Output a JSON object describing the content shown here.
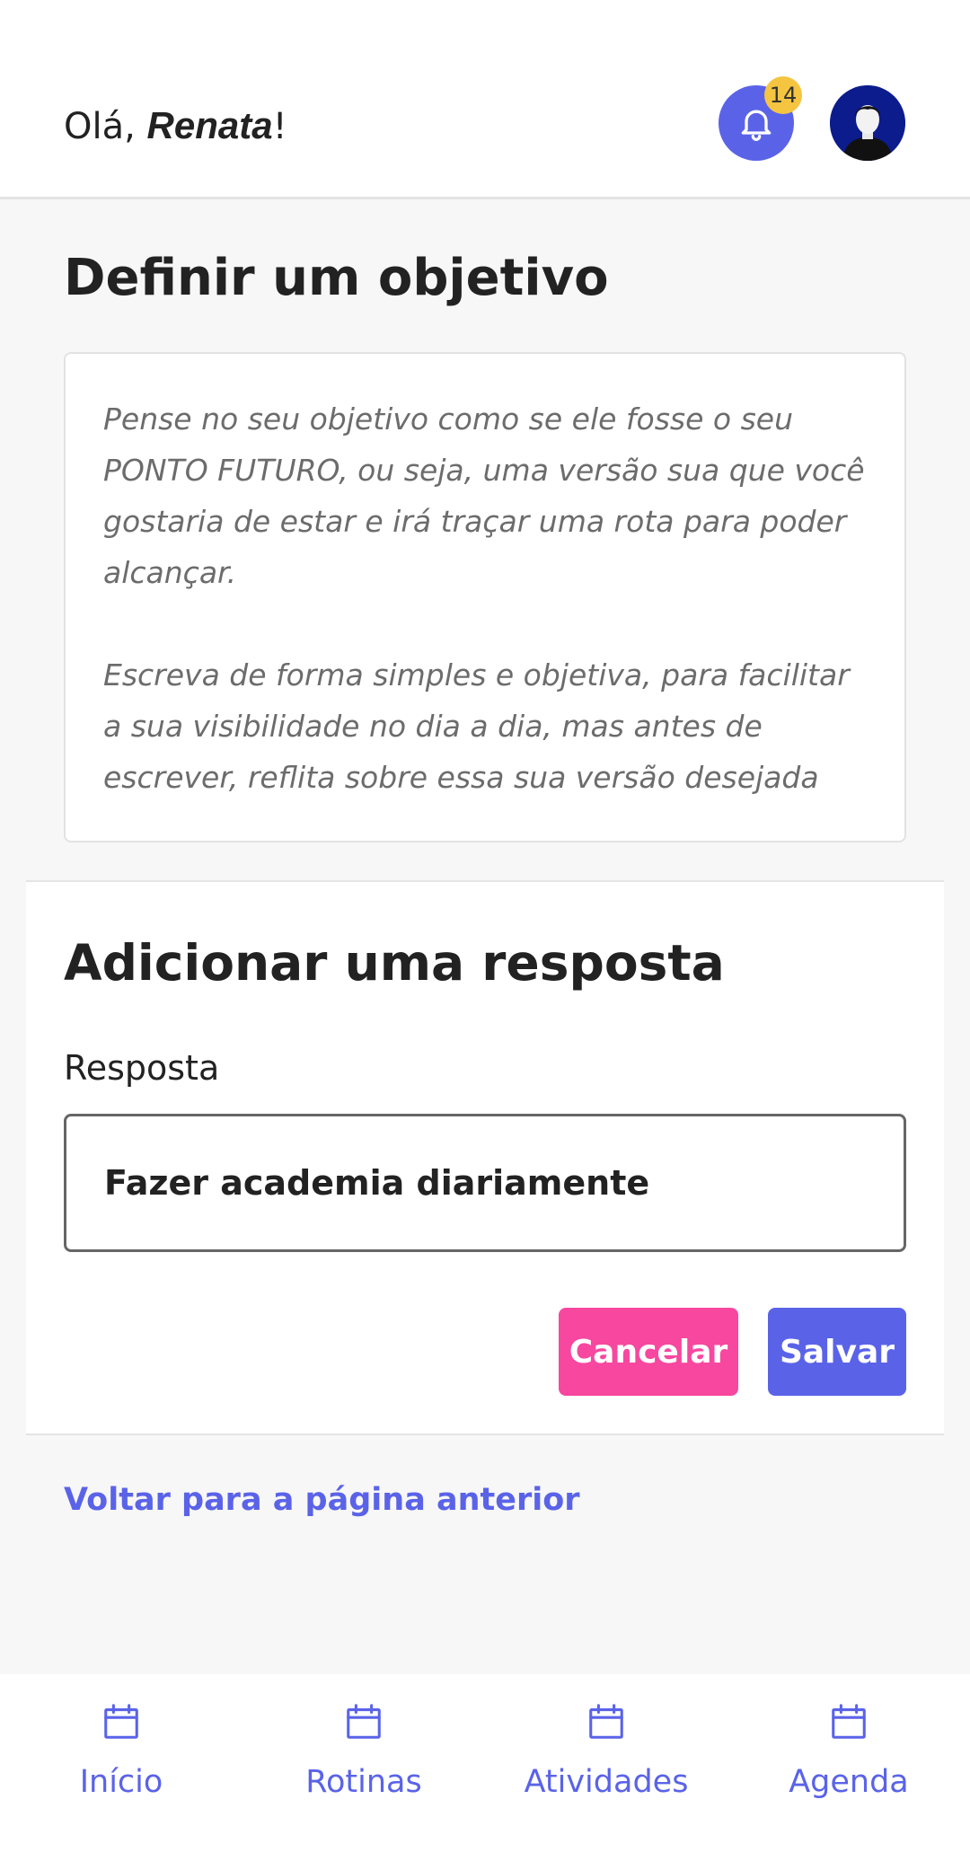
{
  "header": {
    "greeting_prefix": "Olá, ",
    "user_name": "Renata",
    "greeting_suffix": "!",
    "notification_count": "14"
  },
  "page": {
    "title": "Definir um objetivo",
    "info_text": "Pense no seu objetivo como se ele fosse o seu PONTO FUTURO, ou seja, uma versão sua que você gostaria de estar e irá traçar uma rota para poder alcançar.\n\nEscreva de forma simples e objetiva, para facilitar a sua visibilidade no dia a dia, mas antes de escrever, reflita sobre essa sua versão desejada"
  },
  "answer_form": {
    "title": "Adicionar uma resposta",
    "field_label": "Resposta",
    "field_value": "Fazer academia diariamente",
    "cancel_label": "Cancelar",
    "save_label": "Salvar"
  },
  "back_link": "Voltar para a página anterior",
  "nav": {
    "items": [
      {
        "label": "Início",
        "icon": "calendar-icon"
      },
      {
        "label": "Rotinas",
        "icon": "calendar-icon"
      },
      {
        "label": "Atividades",
        "icon": "calendar-icon"
      },
      {
        "label": "Agenda",
        "icon": "calendar-icon"
      }
    ]
  },
  "colors": {
    "accent": "#5a63e8",
    "cancel": "#f7479f",
    "badge": "#f5c542",
    "avatar_bg": "#0c1c8c"
  }
}
